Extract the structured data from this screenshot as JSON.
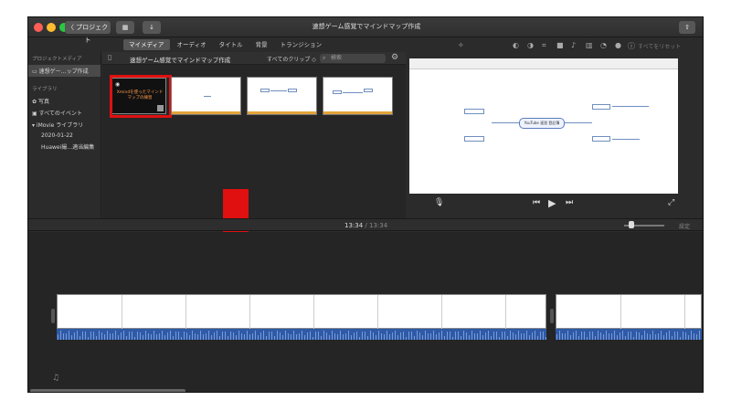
{
  "titlebar": {
    "back_label": "〈 プロジェクト",
    "title": "速想ゲーム感覚でマインドマップ作成"
  },
  "tabs": [
    "マイメディア",
    "オーディオ",
    "タイトル",
    "背景",
    "トランジション"
  ],
  "viewer_toolbar": {
    "reset_label": "すべてをリセット"
  },
  "sidebar": {
    "project_media_label": "プロジェクトメディア",
    "project_item": "速想ゲー…ップ作成",
    "library_label": "ライブラリ",
    "items": [
      "写真",
      "すべてのイベント",
      "iMovie ライブラリ",
      "2020-01-22",
      "Huawei撮…適当編集"
    ]
  },
  "browser": {
    "title": "速想ゲーム感覚でマインドマップ作成",
    "filter": "すべてのクリップ ◇",
    "search_placeholder": "検索",
    "clip1_text": "Xmindを使ったマインドマップの練習"
  },
  "viewer": {
    "center_node": "YouTube 速習 登記簿"
  },
  "timeline_bar": {
    "time_current": "13:34",
    "time_separator": "/",
    "time_total": "13:34",
    "settings_label": "設定"
  },
  "colors": {
    "accent_red": "#e01010",
    "audio_blue": "#2e5aa7",
    "clip_highlight": "#e2a43a"
  }
}
